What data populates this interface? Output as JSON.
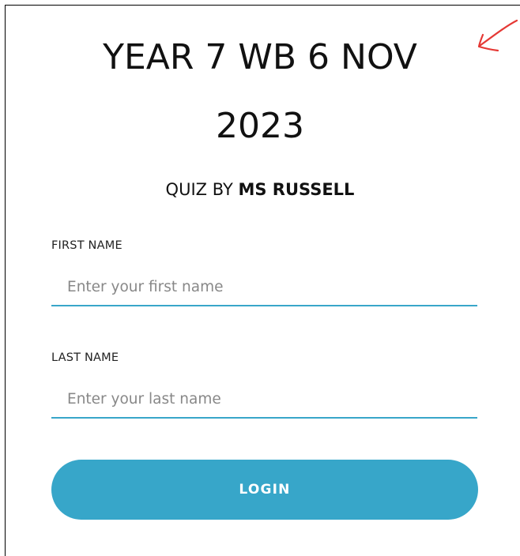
{
  "quiz": {
    "title_line1": "YEAR 7 WB 6 NOV",
    "title_line2": "2023",
    "subtitle_prefix": "QUIZ BY ",
    "author": "MS RUSSELL"
  },
  "form": {
    "first_name": {
      "label": "FIRST NAME",
      "placeholder": "Enter your first name",
      "value": ""
    },
    "last_name": {
      "label": "LAST NAME",
      "placeholder": "Enter your last name",
      "value": ""
    },
    "login_label": "LOGIN"
  },
  "annotation": {
    "icon": "red-arrow-icon",
    "color": "#e53935"
  },
  "colors": {
    "accent": "#37a6c9",
    "input_underline": "#38a6c9",
    "text": "#111111",
    "placeholder": "#888888"
  }
}
